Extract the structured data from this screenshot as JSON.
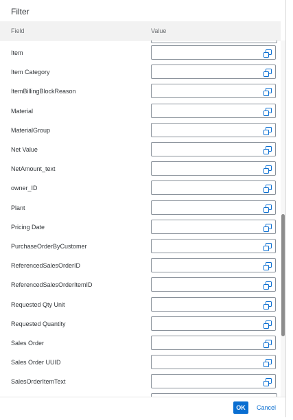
{
  "dialog": {
    "title": "Filter",
    "columns": {
      "field": "Field",
      "value": "Value"
    },
    "rows": [
      {
        "label": "Item",
        "value": ""
      },
      {
        "label": "Item Category",
        "value": ""
      },
      {
        "label": "ItemBillingBlockReason",
        "value": ""
      },
      {
        "label": "Material",
        "value": ""
      },
      {
        "label": "MaterialGroup",
        "value": ""
      },
      {
        "label": "Net Value",
        "value": ""
      },
      {
        "label": "NetAmount_text",
        "value": ""
      },
      {
        "label": "owner_ID",
        "value": ""
      },
      {
        "label": "Plant",
        "value": ""
      },
      {
        "label": "Pricing Date",
        "value": ""
      },
      {
        "label": "PurchaseOrderByCustomer",
        "value": ""
      },
      {
        "label": "ReferencedSalesOrderID",
        "value": ""
      },
      {
        "label": "ReferencedSalesOrderItemID",
        "value": ""
      },
      {
        "label": "Requested Qty Unit",
        "value": ""
      },
      {
        "label": "Requested Quantity",
        "value": ""
      },
      {
        "label": "Sales Order",
        "value": ""
      },
      {
        "label": "Sales Order UUID",
        "value": ""
      },
      {
        "label": "SalesOrderItemText",
        "value": ""
      }
    ],
    "value_help_icon": "value-help-icon",
    "footer": {
      "ok_label": "OK",
      "cancel_label": "Cancel"
    }
  },
  "colors": {
    "accent": "#0a6ed1",
    "header_bg": "#f2f2f2",
    "field_border": "#89919a"
  }
}
